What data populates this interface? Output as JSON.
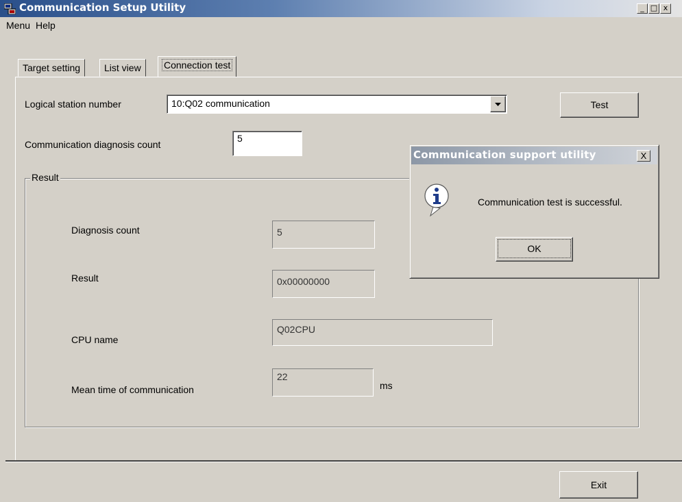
{
  "window": {
    "title": "Communication Setup Utility"
  },
  "titlebar_buttons": {
    "minimize": "_",
    "maximize": "□",
    "close": "x"
  },
  "menu": {
    "items": [
      "Menu",
      "Help"
    ]
  },
  "tabs": [
    {
      "label": "Target setting",
      "active": false
    },
    {
      "label": "List view",
      "active": false
    },
    {
      "label": "Connection test",
      "active": true
    }
  ],
  "connection_test": {
    "logical_station_label": "Logical station number",
    "logical_station_value": "10:Q02 communication",
    "test_button": "Test",
    "diagnosis_count_label": "Communication diagnosis count",
    "diagnosis_count_value": "5",
    "result_group_label": "Result",
    "results": {
      "diagnosis_count_label": "Diagnosis count",
      "diagnosis_count_value": "5",
      "result_label": "Result",
      "result_value": "0x00000000",
      "cpu_name_label": "CPU name",
      "cpu_name_value": "Q02CPU",
      "mean_time_label": "Mean time of communication",
      "mean_time_value": "22",
      "mean_time_unit": "ms"
    }
  },
  "footer": {
    "exit_button": "Exit"
  },
  "dialog": {
    "title": "Communication support utility",
    "close": "X",
    "message": "Communication test is successful.",
    "ok_button": "OK",
    "icon": "info-icon"
  },
  "colors": {
    "titlebar": "#2a4f8a",
    "face": "#d4d0c8",
    "info_icon": "#1f3c8a"
  }
}
